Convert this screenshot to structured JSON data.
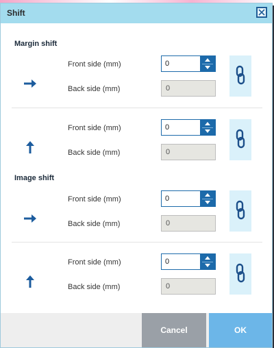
{
  "dialog": {
    "title": "Shift",
    "close_icon": "close-icon"
  },
  "margin_shift": {
    "title": "Margin shift",
    "horizontal": {
      "direction_icon": "arrow-right-icon",
      "front_label": "Front side (mm)",
      "front_value": "0",
      "back_label": "Back side (mm)",
      "back_value": "0",
      "link_icon": "link-chain-icon"
    },
    "vertical": {
      "direction_icon": "arrow-up-icon",
      "front_label": "Front side (mm)",
      "front_value": "0",
      "back_label": "Back side (mm)",
      "back_value": "0",
      "link_icon": "link-chain-icon"
    }
  },
  "image_shift": {
    "title": "Image shift",
    "horizontal": {
      "direction_icon": "arrow-right-icon",
      "front_label": "Front side (mm)",
      "front_value": "0",
      "back_label": "Back side (mm)",
      "back_value": "0",
      "link_icon": "link-chain-icon"
    },
    "vertical": {
      "direction_icon": "arrow-up-icon",
      "front_label": "Front side (mm)",
      "front_value": "0",
      "back_label": "Back side (mm)",
      "back_value": "0",
      "link_icon": "link-chain-icon"
    }
  },
  "footer": {
    "cancel_label": "Cancel",
    "ok_label": "OK"
  },
  "colors": {
    "titlebar": "#a3dcee",
    "accent": "#1c6aaa",
    "ok": "#6cb6e8",
    "cancel": "#9aa0a7",
    "link_button_bg": "#daf1fa"
  }
}
